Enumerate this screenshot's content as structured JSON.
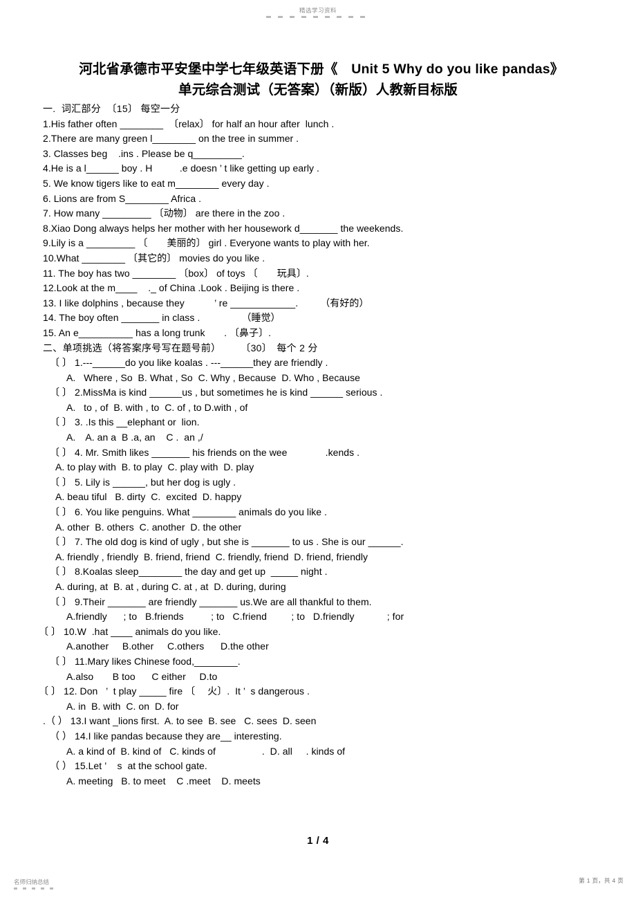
{
  "header": {
    "watermark": "精选学习资料"
  },
  "title": "河北省承德市平安堡中学七年级英语下册《　Unit 5 Why do you like pandas》单元综合测试（无答案）（新版）人教新目标版",
  "sections": [
    {
      "heading": "一.  词汇部分  〔15〕 每空一分",
      "items": [
        "1.His father often ________  〔relax〕 for half an hour after  lunch .",
        "2.There are many green l________ on the tree in summer .",
        "3. Classes beg    .ins . Please be q_________.",
        "4.He is a l______ boy . H          .e doesn ’ t like getting up early .",
        "5. We know tigers like to eat m________ every day .",
        "6. Lions are from S________ Africa .",
        "7. How many _________ 〔动物〕 are there in the zoo .",
        "8.Xiao Dong always helps her mother with her housework d_______ the weekends.",
        "9.Lily is a _________ 〔　　美丽的〕 girl . Everyone wants to play with her.",
        "10.What ________ 〔其它的〕 movies do you like .",
        "11. The boy has two ________ 〔box〕 of toys 〔　　玩具〕.",
        "12.Look at the m____    ._ of China .Look . Beijing is there .",
        "13. I like dolphins , because they           ’ re ____________.　　 （有好的）",
        "14. The boy often _______ in class .　　　　 （睡觉）",
        "15. An e__________ has a long trunk       . 〔鼻子〕."
      ]
    },
    {
      "heading": "二、单项挑选（将答案序号写在题号前）　　　〔30〕　每个 2 分",
      "items": [
        "〔 〕 1.---______do you like koalas . ---______they are friendly .",
        "A.   Where , So  B. What , So  C. Why , Because  D. Who , Because",
        "〔 〕 2.MissMa is kind ______us , but sometimes he is kind ______ serious .",
        "A.   to , of  B. with , to  C. of , to D.with , of",
        "〔 〕 3. .Is this __elephant or  lion.",
        "A.　A. an a  B .a, an    C .  an ,/",
        "〔 〕 4. Mr. Smith likes _______ his friends on the wee              .kends .",
        "A. to play with  B. to play  C. play with  D. play",
        "〔 〕 5. Lily is ______, but her dog is ugly .",
        "A. beau tiful   B. dirty  C.  excited  D. happy",
        "〔 〕 6. You like penguins. What ________ animals do you like .",
        "A. other  B. others  C. another  D. the other",
        "〔 〕 7. The old dog is kind of ugly , but she is _______ to us . She is our ______.",
        "A. friendly , friendly  B. friend, friend  C. friendly, friend  D. friend, friendly",
        "〔 〕 8.Koalas sleep________ the day and get up  _____ night .",
        "A. during, at  B. at , during C. at , at  D. during, during",
        "〔 〕 9.Their _______ are friendly _______ us.We are all thankful to them.",
        "A.friendly      ; to   B.friends          ; to   C.friend         ; to   D.friendly            ; for",
        "〔 〕 10.W  .hat ____ animals do you like.",
        "A.another     B.other     C.others      D.the other",
        "〔 〕 11.Mary likes Chinese food,________.",
        "A.also       B too      C either     D.to",
        "〔 〕 12. Don   ’  t play _____ fire 〔　 火〕.  It ’  s dangerous .",
        "A. in  B. with  C. on  D. for",
        ".（ ） 13.I want _lions first.  A. to see  B. see   C. sees  D. seen",
        "（ ） 14.I like pandas because they are__ interesting.",
        "A. a kind of  B. kind of   C. kinds of                 .  D. all     . kinds of",
        "（ ） 15.Let ’    s  at the school gate.",
        "A. meeting   B. to meet    C .meet    D. meets"
      ]
    }
  ],
  "page_number": "1 / 4",
  "footer": {
    "left": "名师归纳总结",
    "right": "第 1 页，共 4 页"
  }
}
